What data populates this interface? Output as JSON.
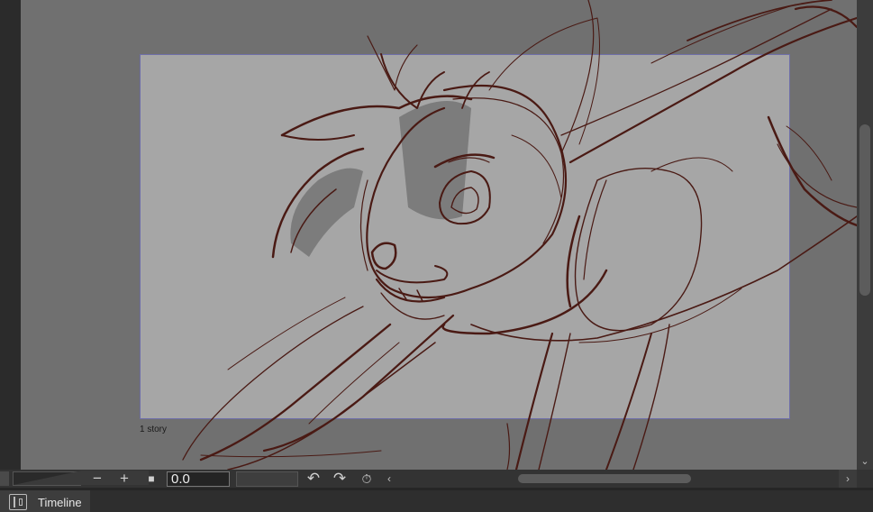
{
  "canvas": {
    "frame_label": "1 story"
  },
  "toolbar": {
    "minus_label": "−",
    "plus_label": "+",
    "stop_label": "■",
    "angle_value": "0.0",
    "rotate_ccw_label": "↶",
    "rotate_cw_label": "↷",
    "reset_label": "⏱",
    "scroll_left_label": "‹",
    "scroll_right_label": "›",
    "scroll_down_label": "⌄"
  },
  "panel": {
    "timeline_label": "Timeline"
  },
  "colors": {
    "stroke": "#4a1a14",
    "paper": "#a6a6a6",
    "canvas": "#707070"
  }
}
